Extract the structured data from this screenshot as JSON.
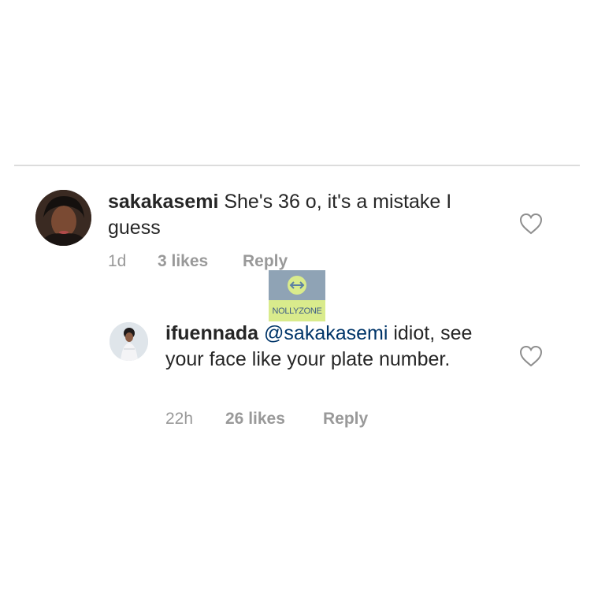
{
  "comments": [
    {
      "username": "sakakasemi",
      "text": " She's 36 o, it's a mistake I guess",
      "time": "1d",
      "likes": "3 likes",
      "reply": "Reply"
    }
  ],
  "reply_comment": {
    "username": "ifuennada",
    "mention": "@sakakasemi",
    "text": " idiot, see your face like your plate number.",
    "time": "22h",
    "likes": "26 likes",
    "reply": "Reply"
  },
  "watermark": {
    "label": "NOLLYZONE"
  },
  "icons": [
    "heart-icon",
    "avatar",
    "watermark-logo-icon"
  ],
  "colors": {
    "text": "#262626",
    "meta": "#999999",
    "mention": "#003569",
    "divider": "#dcdcdc"
  }
}
